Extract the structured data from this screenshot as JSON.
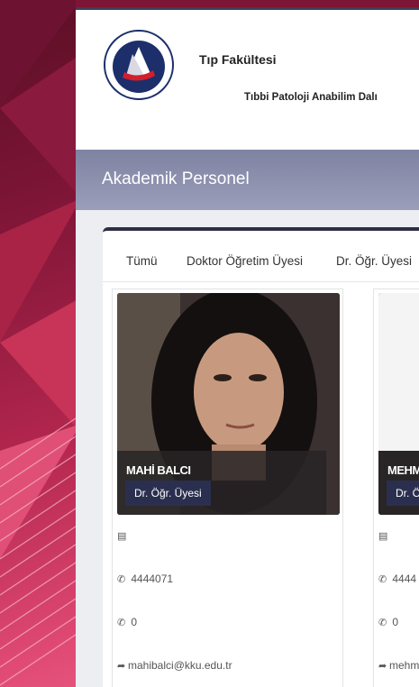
{
  "header": {
    "faculty": "Tıp Fakültesi",
    "department": "Tıbbi Patoloji Anabilim Dalı",
    "logo_text": "KIRIKKALE ÜNİVERSİTESİ",
    "logo_year": "1992"
  },
  "banner": {
    "title": "Akademik Personel"
  },
  "tabs": [
    {
      "label": "Tümü"
    },
    {
      "label": "Doktor Öğretim Üyesi"
    },
    {
      "label": "Dr. Öğr. Üyesi"
    }
  ],
  "staff": [
    {
      "name": "MAHİ BALCI",
      "role": "Dr. Öğr. Üyesi",
      "phone": "4444071",
      "phone2": "0",
      "email": "mahibalci@kku.edu.tr"
    },
    {
      "name": "MEHM",
      "role": "Dr. Ö",
      "phone": "4444",
      "phone2": "0",
      "email": "mehm"
    }
  ],
  "icons": {
    "office": "building-icon",
    "phone": "phone-icon",
    "email": "share-icon"
  },
  "colors": {
    "accent": "#2b2f4f",
    "banner": "#8a8eab",
    "background": "#b3264e"
  }
}
